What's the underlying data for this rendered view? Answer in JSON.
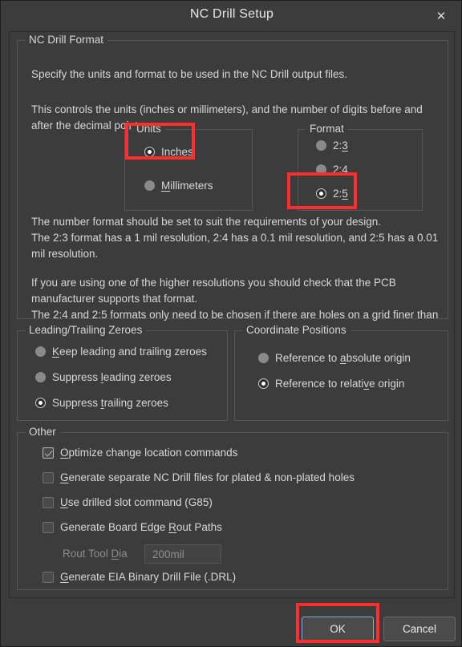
{
  "window": {
    "title": "NC Drill Setup",
    "close_icon": "close-icon",
    "close_glyph": "✕"
  },
  "format_group": {
    "legend": "NC Drill Format",
    "paragraph_1": "Specify the units and format to be used in the NC Drill output files.",
    "paragraph_2": "This controls the units (inches or millimeters), and the number of digits before and\nafter the decimal point.",
    "paragraph_3": "The number format should be set to suit the requirements of your design.\nThe 2:3 format has a 1 mil resolution, 2:4 has a 0.1 mil resolution, and 2:5 has a 0.01\nmil resolution.",
    "paragraph_4": "If you are using one of the higher resolutions you should check that the PCB\nmanufacturer supports that format.\nThe 2:4 and 2:5 formats only need to be chosen if there are holes on a grid finer than"
  },
  "units_group": {
    "legend": "Units",
    "options": [
      {
        "label": "Inches",
        "accel": "I",
        "selected": true
      },
      {
        "label": "Millimeters",
        "accel": "M",
        "selected": false
      }
    ]
  },
  "format_options_group": {
    "legend": "Format",
    "options": [
      {
        "label": "2:3",
        "accel": "3",
        "selected": false
      },
      {
        "label": "2:4",
        "accel": "4",
        "selected": false
      },
      {
        "label": "2:5",
        "accel": "5",
        "selected": true
      }
    ]
  },
  "zeroes_group": {
    "legend": "Leading/Trailing Zeroes",
    "options": [
      {
        "label": "Keep leading and trailing zeroes",
        "accel": "K",
        "selected": false
      },
      {
        "label": "Suppress leading zeroes",
        "accel": "l",
        "selected": false
      },
      {
        "label": "Suppress trailing zeroes",
        "accel": "t",
        "selected": true
      }
    ]
  },
  "coordinates_group": {
    "legend": "Coordinate Positions",
    "options": [
      {
        "label": "Reference to absolute origin",
        "accel": "a",
        "selected": false
      },
      {
        "label": "Reference to relative origin",
        "accel": "v",
        "selected": true
      }
    ]
  },
  "other_group": {
    "legend": "Other",
    "checkboxes": [
      {
        "label": "Optimize change location commands",
        "accel": "O",
        "checked": true
      },
      {
        "label": "Generate separate NC Drill files for plated & non-plated holes",
        "accel": "G",
        "checked": false
      },
      {
        "label": "Use drilled slot command (G85)",
        "accel": "U",
        "checked": false
      },
      {
        "label": "Generate Board Edge Rout Paths",
        "accel": "R",
        "checked": false
      },
      {
        "label": "Generate EIA Binary Drill File (.DRL)",
        "accel": "E",
        "checked": false
      }
    ],
    "rout_tool": {
      "label": "Rout Tool Dia",
      "accel": "D",
      "value": "200mil",
      "disabled": true
    }
  },
  "footer": {
    "ok_label": "OK",
    "cancel_label": "Cancel"
  },
  "annotations": {
    "highlight_color": "#ff2d2d",
    "boxes": [
      "inches-radio",
      "format-2-5-radio",
      "ok-button"
    ]
  }
}
